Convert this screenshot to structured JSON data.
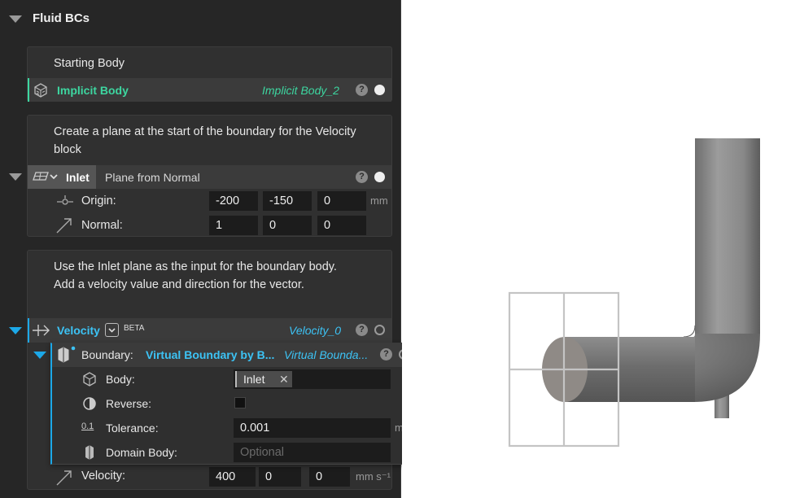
{
  "section": {
    "title": "Fluid BCs"
  },
  "starting_body": {
    "heading": "Starting Body",
    "row": {
      "type": "Implicit Body",
      "value": "Implicit Body_2"
    }
  },
  "inlet": {
    "note": "Create a plane at the start of the boundary for the Velocity block",
    "name": "Inlet",
    "mode": "Plane from Normal",
    "origin": {
      "label": "Origin:",
      "x": "-200",
      "y": "-150",
      "z": "0",
      "unit": "mm"
    },
    "normal": {
      "label": "Normal:",
      "x": "1",
      "y": "0",
      "z": "0"
    }
  },
  "velocity": {
    "note": "Use the Inlet plane as the input for the boundary body. Add a velocity value and direction for the vector.",
    "name": "Velocity",
    "badge": "BETA",
    "value": "Velocity_0",
    "boundary": {
      "label": "Boundary:",
      "type": "Virtual Boundary by B...",
      "value": "Virtual Bounda...",
      "body": {
        "label": "Body:",
        "chip": "Inlet"
      },
      "reverse": {
        "label": "Reverse:"
      },
      "tolerance": {
        "label": "Tolerance:",
        "value": "0.001",
        "unit": "mm",
        "icon_text": "0.1"
      },
      "domain_body": {
        "label": "Domain Body:",
        "placeholder": "Optional"
      }
    },
    "vector": {
      "label": "Velocity:",
      "x": "400",
      "y": "0",
      "z": "0",
      "unit": "mm s⁻¹"
    }
  },
  "colors": {
    "accent_green": "#3dd6a0",
    "accent_blue": "#3cc3f5",
    "panel_bg": "#262626"
  },
  "icons": [
    "collapse-triangle-icon",
    "implicit-body-icon",
    "plane-icon",
    "chevron-down-icon",
    "origin-icon",
    "normal-arrow-icon",
    "velocity-icon",
    "boundary-icon",
    "body-icon",
    "reverse-icon",
    "tolerance-icon",
    "domain-body-icon",
    "vector-arrow-icon",
    "help-icon",
    "remove-icon"
  ]
}
